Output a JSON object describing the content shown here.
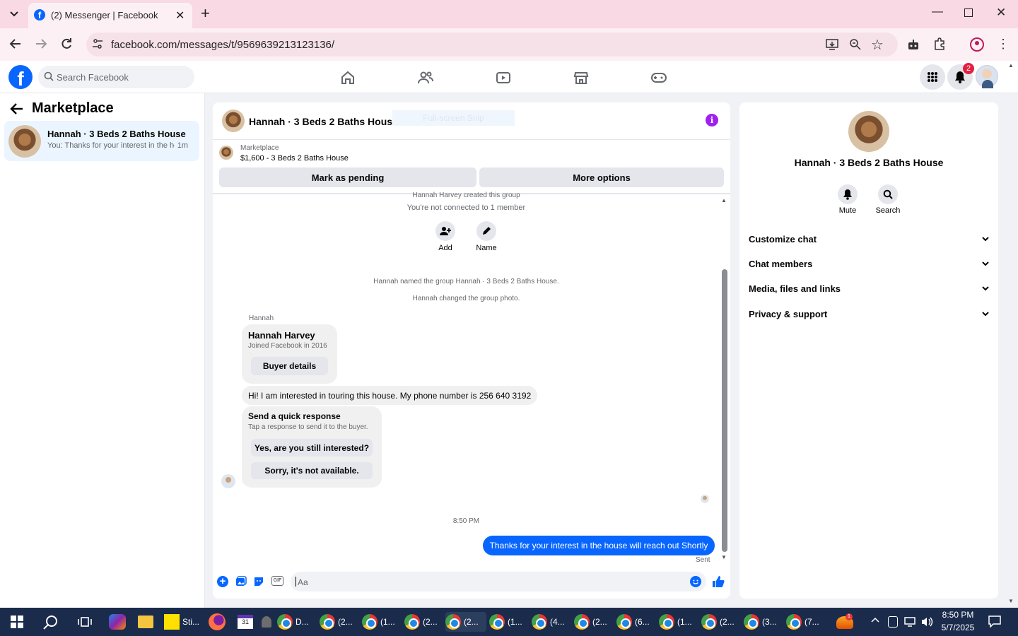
{
  "browser": {
    "tab_title": "(2) Messenger | Facebook",
    "url": "facebook.com/messages/t/9569639213123136/"
  },
  "fb": {
    "search_placeholder": "Search Facebook",
    "notif_count": "2"
  },
  "left": {
    "title": "Marketplace",
    "thread": {
      "name": "Hannah · 3 Beds 2 Baths House",
      "preview": "You: Thanks for your interest in the h...",
      "time": "· 1m"
    }
  },
  "chat": {
    "title": "Hannah · 3 Beds 2 Baths House",
    "snip_overlay": "Full-screen Snip",
    "listing": {
      "source": "Marketplace",
      "price_title": "$1,600 - 3 Beds 2 Baths House"
    },
    "mark_pending": "Mark as pending",
    "more_options": "More options",
    "created_by": "Hannah Harvey created this group",
    "not_connected": "You're not connected to 1 member",
    "add_label": "Add",
    "name_label": "Name",
    "named_event": "Hannah named the group Hannah · 3 Beds 2 Baths House.",
    "photo_event": "Hannah changed the group photo.",
    "sender": "Hannah",
    "card": {
      "name": "Hannah Harvey",
      "joined": "Joined Facebook in 2016",
      "button": "Buyer details"
    },
    "message": "Hi! I am interested in touring this house. My phone number is 256 640 3192",
    "quick": {
      "title": "Send a quick response",
      "subtitle": "Tap a response to send it to the buyer.",
      "option1": "Yes, are you still interested?",
      "option2": "Sorry, it's not available."
    },
    "timestamp": "8:50 PM",
    "my_message": "Thanks for your interest in the house will reach out Shortly",
    "sent_status": "Sent",
    "composer_placeholder": "Aa",
    "gif_label": "GIF"
  },
  "right": {
    "name": "Hannah · 3 Beds 2 Baths House",
    "mute": "Mute",
    "search": "Search",
    "sections": [
      "Customize chat",
      "Chat members",
      "Media, files and links",
      "Privacy & support"
    ]
  },
  "taskbar": {
    "apps": [
      "Sti...",
      "D...",
      "(2...",
      "(1...",
      "(2...",
      "(2...",
      "(1...",
      "(4...",
      "(2...",
      "(6...",
      "(1...",
      "(2...",
      "(3...",
      "(7..."
    ],
    "time": "8:50 PM",
    "date": "5/7/2025",
    "badge": "1"
  },
  "colors": {
    "fb_blue": "#0866ff",
    "purple_info": "#a020f0",
    "tab_pink": "#f9d9e3"
  }
}
